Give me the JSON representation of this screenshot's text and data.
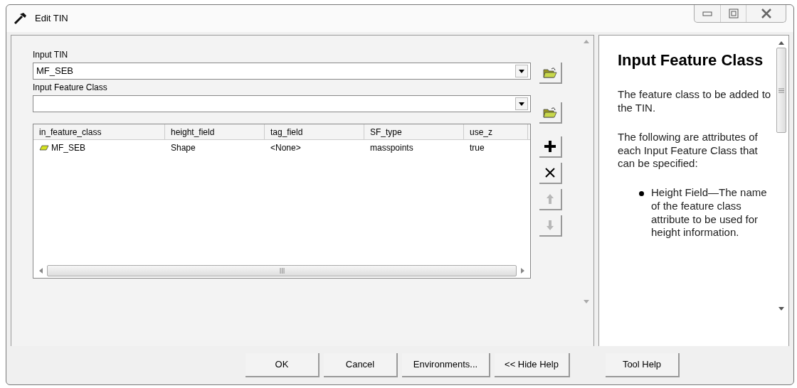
{
  "window": {
    "title": "Edit TIN"
  },
  "fields": [
    {
      "label": "Input TIN",
      "value": "MF_SEB"
    },
    {
      "label": "Input Feature Class"
    }
  ],
  "table": {
    "columns": [
      "in_feature_class",
      "height_field",
      "tag_field",
      "SF_type",
      "use_z"
    ],
    "rows": [
      {
        "cells": [
          "MF_SEB",
          "Shape",
          "<None>",
          "masspoints",
          "true"
        ]
      }
    ]
  },
  "side_tools": [
    {
      "kind": "add",
      "disabled": false
    },
    {
      "kind": "remove",
      "disabled": false
    },
    {
      "kind": "up",
      "disabled": true
    },
    {
      "kind": "down",
      "disabled": true
    }
  ],
  "help": {
    "title": "Input Feature Class",
    "paragraphs": [
      "The feature class to be added to the TIN.",
      "The following are attributes of each Input Feature Class that can be specified:"
    ],
    "bullets": [
      "Height Field—The name of the feature class attribute to be used for height information."
    ]
  },
  "buttons": [
    {
      "label": "OK"
    },
    {
      "label": "Cancel"
    },
    {
      "label": "Environments..."
    },
    {
      "label": "<< Hide Help"
    }
  ],
  "tool_help_button": {
    "label": "Tool Help"
  }
}
